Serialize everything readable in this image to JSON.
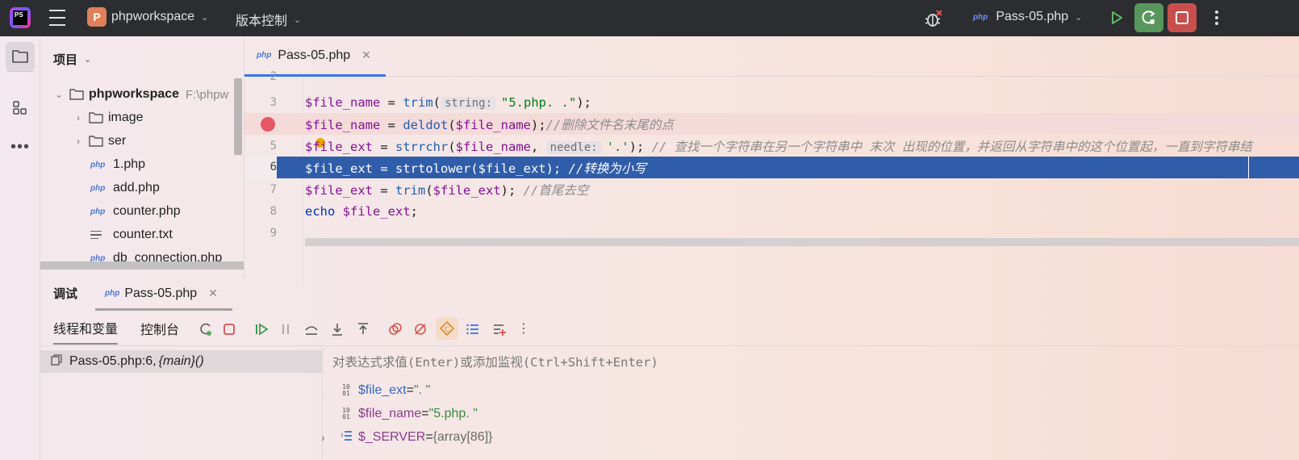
{
  "titlebar": {
    "project_badge": "P",
    "project_name": "phpworkspace",
    "vcs_label": "版本控制",
    "run_config": "Pass-05.php",
    "run_config_tag": "php"
  },
  "project_panel": {
    "title": "项目",
    "root": {
      "name": "phpworkspace",
      "path": "F:\\phpw"
    },
    "items": [
      {
        "type": "folder",
        "name": "image"
      },
      {
        "type": "folder",
        "name": "ser"
      },
      {
        "type": "php",
        "name": "1.php"
      },
      {
        "type": "php",
        "name": "add.php"
      },
      {
        "type": "php",
        "name": "counter.php"
      },
      {
        "type": "txt",
        "name": "counter.txt"
      },
      {
        "type": "php",
        "name": "db_connection.php"
      }
    ],
    "php_tag": "php"
  },
  "editor": {
    "tab_label": "Pass-05.php",
    "tab_tag": "php",
    "lines": {
      "l2": {
        "num": "2"
      },
      "l3": {
        "num": "3",
        "var": "$file_name",
        "op": " = ",
        "fn": "trim",
        "open": "(",
        "hint": "string:",
        "str": "\"5.php. .\"",
        "end": ");"
      },
      "l4": {
        "var": "$file_name",
        "op": " = ",
        "fn": "deldot",
        "open": "(",
        "arg": "$file_name",
        "end": ");",
        "cmt": "//删除文件名末尾的点"
      },
      "l5": {
        "num": "5",
        "var": "$file_ext",
        "op": " = ",
        "fn": "strrchr",
        "open": "(",
        "arg": "$file_name",
        "comma": ", ",
        "hint": "needle:",
        "str": "'.'",
        "end": "); ",
        "cmt": "// 查找一个字符串在另一个字符串中 末次 出现的位置，并返回从字符串中的这个位置起，一直到字符串结"
      },
      "l6": {
        "num": "6",
        "var": "$file_ext",
        "op": " = ",
        "fn": "strtolower",
        "open": "(",
        "arg": "$file_ext",
        "end": "); ",
        "cmt": "//转换为小写"
      },
      "l7": {
        "num": "7",
        "var": "$file_ext",
        "op": " = ",
        "fn": "trim",
        "open": "(",
        "arg": "$file_ext",
        "end": "); ",
        "cmt": "//首尾去空"
      },
      "l8": {
        "num": "8",
        "kw": "echo",
        "sp": " ",
        "var": "$file_ext",
        "end": ";"
      },
      "l9": {
        "num": "9"
      }
    }
  },
  "debug": {
    "title": "调试",
    "session_tab": "Pass-05.php",
    "session_tag": "php",
    "tabs": {
      "threads": "线程和变量",
      "console": "控制台"
    },
    "frame": {
      "label": "Pass-05.php:6, ",
      "fn": "{main}()"
    },
    "eval_placeholder": "对表达式求值(Enter)或添加监视(Ctrl+Shift+Enter)",
    "variables": [
      {
        "name": "$file_ext",
        "eq": " = ",
        "value": "\". \""
      },
      {
        "name": "$file_name",
        "eq": " = ",
        "value": "\"5.php. \""
      },
      {
        "name": "$_SERVER",
        "eq": " = ",
        "value": "{array[86]}"
      }
    ],
    "var_icon": "10\n01"
  },
  "colors": {
    "titlebar_bg": "#2b2d30",
    "selection": "#2f5da9",
    "breakpoint": "#e55765",
    "rerun_bg": "#57965c",
    "stop_bg": "#c94f4f"
  },
  "icons": [
    "logo-icon",
    "hamburger-icon",
    "debug-bug-icon",
    "run-icon",
    "rerun-icon",
    "stop-icon",
    "more-icon",
    "folder-icon",
    "structure-icon",
    "breakpoint-icon"
  ]
}
